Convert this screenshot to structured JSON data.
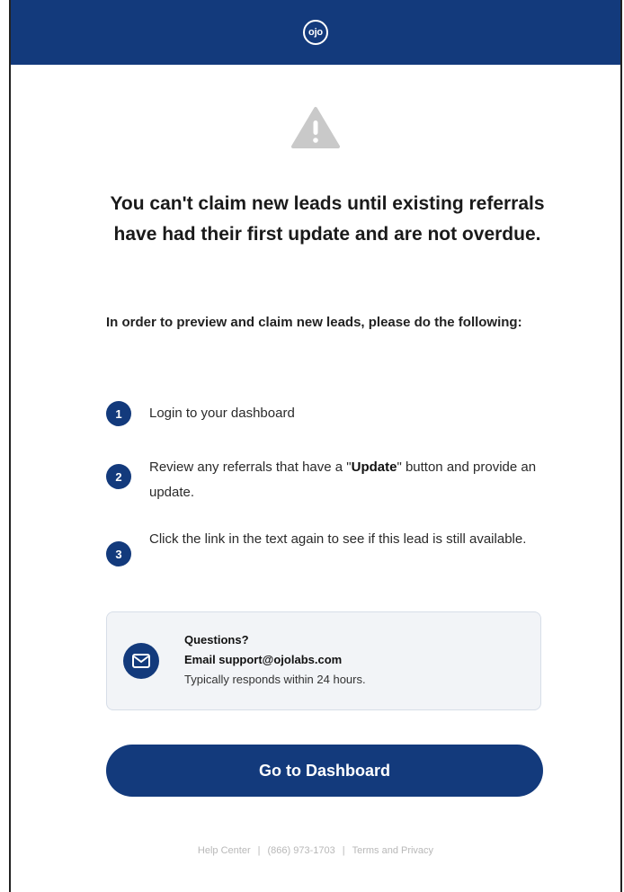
{
  "header": {
    "logo_text": "ojo",
    "brand_color": "#133a7c"
  },
  "alert": {
    "icon": "warning-triangle-icon",
    "icon_color": "#c9c9c9",
    "title": "You can't claim new leads until existing referrals have had their first update and are not overdue."
  },
  "instructions": {
    "intro": "In order to preview and claim new leads, please do the following:",
    "steps": [
      {
        "number": "1",
        "text": "Login to your dashboard"
      },
      {
        "number": "2",
        "text_before": "Review any referrals that have a \"",
        "bold": "Update",
        "text_after": "\" button and provide an update."
      },
      {
        "number": "3",
        "text": "Click the link in the text again to see if this lead is still available."
      }
    ]
  },
  "contact": {
    "icon": "mail-icon",
    "heading": "Questions?",
    "email_line": "Email support@ojolabs.com",
    "response": "Typically responds within 24 hours."
  },
  "cta": {
    "label": "Go to Dashboard"
  },
  "footer": {
    "links": [
      "Help Center",
      "(866) 973-1703",
      "Terms and Privacy"
    ],
    "separator": "|"
  }
}
